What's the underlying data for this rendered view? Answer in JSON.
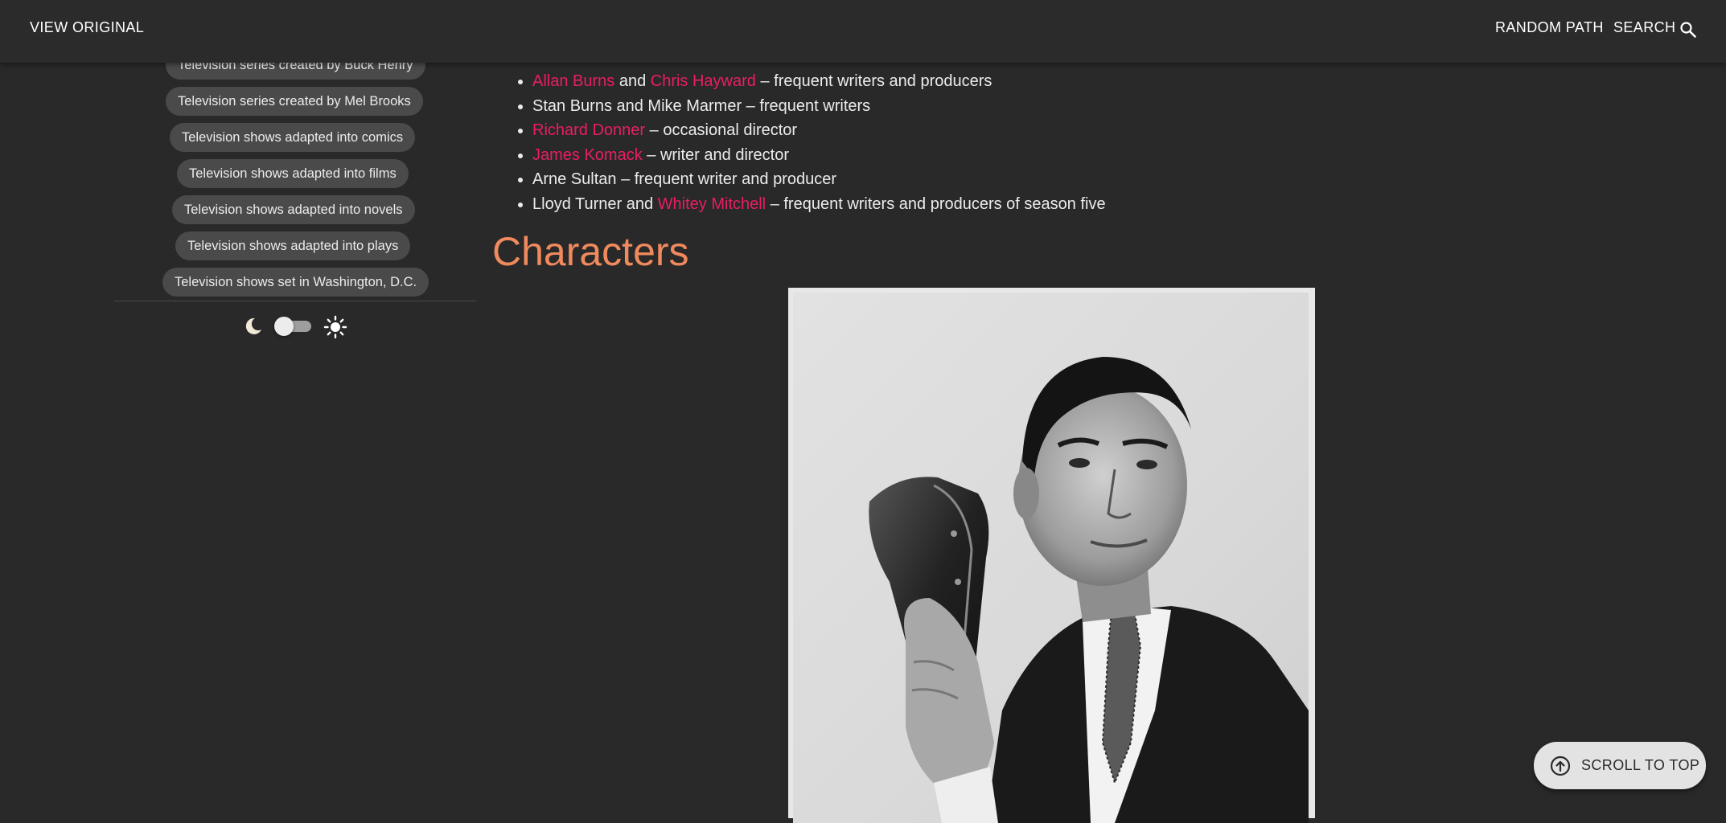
{
  "header": {
    "view_original": "VIEW ORIGINAL",
    "random_path": "RANDOM PATH",
    "search": "SEARCH"
  },
  "sidebar": {
    "categories": [
      "Television series created by Buck Henry",
      "Television series created by Mel Brooks",
      "Television shows adapted into comics",
      "Television shows adapted into films",
      "Television shows adapted into novels",
      "Television shows adapted into plays",
      "Television shows set in Washington, D.C."
    ],
    "theme_toggle": {
      "mode": "dark"
    }
  },
  "content": {
    "credits": [
      {
        "link1": "Allan Burns",
        "mid": " and ",
        "link2": "Chris Hayward",
        "rest": " – frequent writers and producers"
      },
      {
        "text": "Stan Burns and Mike Marmer – frequent writers"
      },
      {
        "link1": "Richard Donner",
        "rest": " – occasional director"
      },
      {
        "link1": "James Komack",
        "rest": " – writer and director"
      },
      {
        "text": "Arne Sultan – frequent writer and producer"
      },
      {
        "pre": "Lloyd Turner and ",
        "link1": "Whitey Mitchell",
        "rest": " – frequent writers and producers of season five"
      }
    ],
    "section_heading": "Characters"
  },
  "scroll_to_top": {
    "label": "SCROLL TO TOP"
  },
  "colors": {
    "background": "#292929",
    "link": "#e91e63",
    "heading": "#f08a5d",
    "chip": "#4a4a4a"
  }
}
